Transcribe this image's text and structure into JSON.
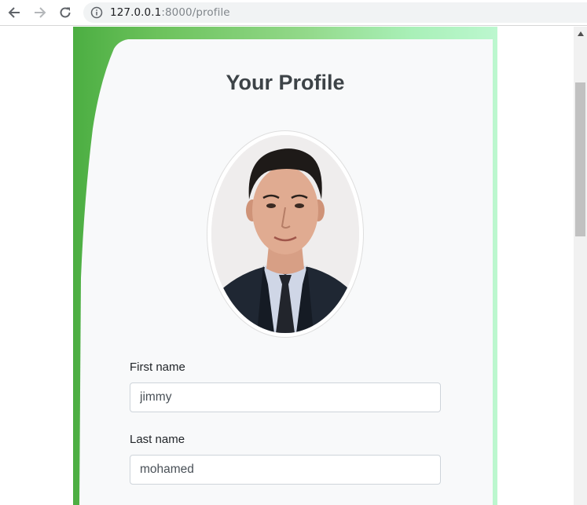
{
  "browser": {
    "url_host": "127.0.0.1",
    "url_path": ":8000/profile"
  },
  "profile": {
    "title": "Your Profile",
    "photo_alt": "profile photo"
  },
  "form": {
    "first_name_label": "First name",
    "first_name_value": "jimmy",
    "last_name_label": "Last name",
    "last_name_value": "mohamed"
  },
  "colors": {
    "panel_gradient_start": "#4cae42",
    "panel_gradient_end": "#bcf7cf",
    "card_background": "#f8f9fa"
  }
}
